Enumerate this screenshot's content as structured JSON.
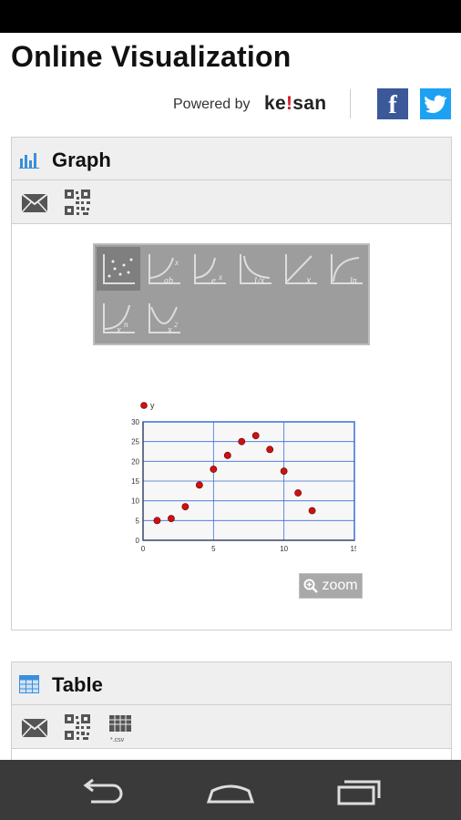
{
  "page": {
    "title": "Online Visualization",
    "powered_by": "Powered by",
    "brand_pre": "ke",
    "brand_dot": "!",
    "brand_post": "san",
    "facebook_letter": "f"
  },
  "graph_panel": {
    "title": "Graph",
    "tools": [
      "mail-icon",
      "qr-code-icon"
    ],
    "chart_type_icons": [
      "scatter",
      "ab^x",
      "e^x",
      "1/x",
      "x",
      "ln",
      "x^n",
      "x^2"
    ],
    "zoom_label": "zoom"
  },
  "table_panel": {
    "title": "Table",
    "tools": [
      "mail-icon",
      "qr-code-icon",
      "csv-icon"
    ],
    "csv_label": "*.csv"
  },
  "colors": {
    "accent": "#3a6fd8",
    "point": "#cc1111",
    "facebook": "#3b5998",
    "twitter": "#1da1f2"
  },
  "chart_data": {
    "type": "scatter",
    "series": [
      {
        "name": "y",
        "x": [
          1,
          2,
          3,
          4,
          5,
          6,
          7,
          8,
          9,
          10,
          11,
          12
        ],
        "y": [
          5,
          5.5,
          8.5,
          14,
          18,
          21.5,
          25,
          26.5,
          23,
          17.5,
          12,
          7.5
        ]
      }
    ],
    "xlim": [
      0,
      15
    ],
    "ylim": [
      0,
      30
    ],
    "xticks": [
      0,
      5,
      10,
      15
    ],
    "yticks": [
      0,
      5,
      10,
      15,
      20,
      25,
      30
    ],
    "grid": true,
    "legend": "top-left"
  }
}
